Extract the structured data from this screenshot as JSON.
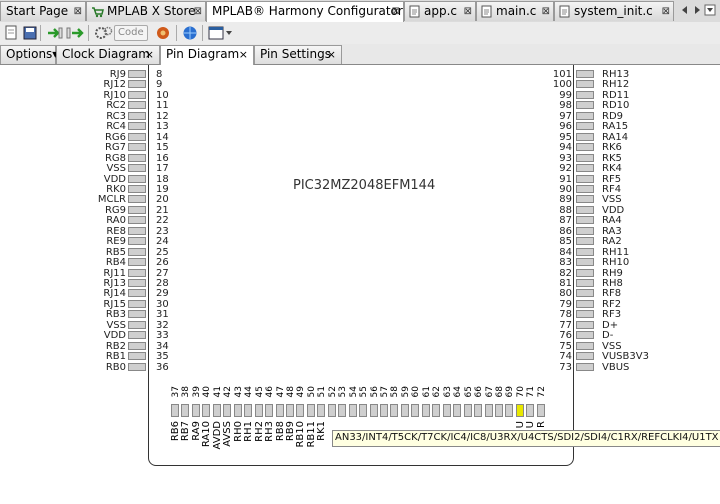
{
  "top_tabs": [
    {
      "label": "Start Page",
      "close": "⊠"
    },
    {
      "label": "MPLAB X Store",
      "close": "⊠"
    },
    {
      "label": "MPLAB® Harmony Configurator",
      "modified": "*",
      "close": "⊠"
    },
    {
      "label": "app.c",
      "close": "⊠"
    },
    {
      "label": "main.c",
      "close": "⊠"
    },
    {
      "label": "system_init.c",
      "close": "⊠"
    }
  ],
  "toolbar": {
    "code_label": "Code"
  },
  "sub_tabs": [
    {
      "label": "Options▾"
    },
    {
      "label": "Clock Diagram",
      "close": "×"
    },
    {
      "label": "Pin Diagram",
      "close": "×"
    },
    {
      "label": "Pin Settings",
      "close": "×"
    }
  ],
  "chip_name": "PIC32MZ2048EFM144",
  "left_pins": [
    {
      "name": "RJ9",
      "num": "8"
    },
    {
      "name": "RJ12",
      "num": "9"
    },
    {
      "name": "RJ10",
      "num": "10"
    },
    {
      "name": "RC2",
      "num": "11"
    },
    {
      "name": "RC3",
      "num": "12"
    },
    {
      "name": "RC4",
      "num": "13"
    },
    {
      "name": "RG6",
      "num": "14"
    },
    {
      "name": "RG7",
      "num": "15"
    },
    {
      "name": "RG8",
      "num": "16"
    },
    {
      "name": "VSS",
      "num": "17"
    },
    {
      "name": "VDD",
      "num": "18"
    },
    {
      "name": "RK0",
      "num": "19"
    },
    {
      "name": "MCLR",
      "num": "20"
    },
    {
      "name": "RG9",
      "num": "21"
    },
    {
      "name": "RA0",
      "num": "22"
    },
    {
      "name": "RE8",
      "num": "23"
    },
    {
      "name": "RE9",
      "num": "24"
    },
    {
      "name": "RB5",
      "num": "25"
    },
    {
      "name": "RB4",
      "num": "26"
    },
    {
      "name": "RJ11",
      "num": "27"
    },
    {
      "name": "RJ13",
      "num": "28"
    },
    {
      "name": "RJ14",
      "num": "29"
    },
    {
      "name": "RJ15",
      "num": "30"
    },
    {
      "name": "RB3",
      "num": "31"
    },
    {
      "name": "VSS",
      "num": "32"
    },
    {
      "name": "VDD",
      "num": "33"
    },
    {
      "name": "RB2",
      "num": "34"
    },
    {
      "name": "RB1",
      "num": "35"
    },
    {
      "name": "RB0",
      "num": "36"
    }
  ],
  "right_pins": [
    {
      "num": "101",
      "name": "RH13"
    },
    {
      "num": "100",
      "name": "RH12"
    },
    {
      "num": "99",
      "name": "RD11"
    },
    {
      "num": "98",
      "name": "RD10"
    },
    {
      "num": "97",
      "name": "RD9"
    },
    {
      "num": "96",
      "name": "RA15"
    },
    {
      "num": "95",
      "name": "RA14"
    },
    {
      "num": "94",
      "name": "RK6"
    },
    {
      "num": "93",
      "name": "RK5"
    },
    {
      "num": "92",
      "name": "RK4"
    },
    {
      "num": "91",
      "name": "RF5"
    },
    {
      "num": "90",
      "name": "RF4"
    },
    {
      "num": "89",
      "name": "VSS"
    },
    {
      "num": "88",
      "name": "VDD"
    },
    {
      "num": "87",
      "name": "RA4"
    },
    {
      "num": "86",
      "name": "RA3"
    },
    {
      "num": "85",
      "name": "RA2"
    },
    {
      "num": "84",
      "name": "RH11"
    },
    {
      "num": "83",
      "name": "RH10"
    },
    {
      "num": "82",
      "name": "RH9"
    },
    {
      "num": "81",
      "name": "RH8"
    },
    {
      "num": "80",
      "name": "RF8"
    },
    {
      "num": "79",
      "name": "RF2"
    },
    {
      "num": "78",
      "name": "RF3"
    },
    {
      "num": "77",
      "name": "D+"
    },
    {
      "num": "76",
      "name": "D-"
    },
    {
      "num": "75",
      "name": "VSS"
    },
    {
      "num": "74",
      "name": "VUSB3V3"
    },
    {
      "num": "73",
      "name": "VBUS"
    }
  ],
  "bottom_pins": [
    {
      "num": "37",
      "name": "RB6"
    },
    {
      "num": "38",
      "name": "RB7"
    },
    {
      "num": "39",
      "name": "RA9"
    },
    {
      "num": "40",
      "name": "RA10"
    },
    {
      "num": "41",
      "name": "AVDD"
    },
    {
      "num": "42",
      "name": "AVSS"
    },
    {
      "num": "43",
      "name": "RH0"
    },
    {
      "num": "44",
      "name": "RH1"
    },
    {
      "num": "45",
      "name": "RH2"
    },
    {
      "num": "46",
      "name": "RH3"
    },
    {
      "num": "47",
      "name": "RB8"
    },
    {
      "num": "48",
      "name": "RB9"
    },
    {
      "num": "49",
      "name": "RB10"
    },
    {
      "num": "50",
      "name": "RB11"
    },
    {
      "num": "51",
      "name": "RK1"
    },
    {
      "num": "52",
      "name": ""
    },
    {
      "num": "53",
      "name": ""
    },
    {
      "num": "54",
      "name": ""
    },
    {
      "num": "55",
      "name": ""
    },
    {
      "num": "56",
      "name": ""
    },
    {
      "num": "57",
      "name": ""
    },
    {
      "num": "58",
      "name": ""
    },
    {
      "num": "59",
      "name": ""
    },
    {
      "num": "60",
      "name": ""
    },
    {
      "num": "61",
      "name": ""
    },
    {
      "num": "62",
      "name": ""
    },
    {
      "num": "63",
      "name": ""
    },
    {
      "num": "64",
      "name": ""
    },
    {
      "num": "65",
      "name": ""
    },
    {
      "num": "66",
      "name": ""
    },
    {
      "num": "67",
      "name": ""
    },
    {
      "num": "68",
      "name": ""
    },
    {
      "num": "69",
      "name": ""
    },
    {
      "num": "70",
      "name": "U"
    },
    {
      "num": "71",
      "name": "U"
    },
    {
      "num": "72",
      "name": "R"
    }
  ],
  "highlighted_pin": "70",
  "tooltip": "AN33/INT4/T5CK/T7CK/IC4/IC8/U3RX/U4CTS/SDI2/SDI4/C1RX/REFCLKI4/U1TX"
}
